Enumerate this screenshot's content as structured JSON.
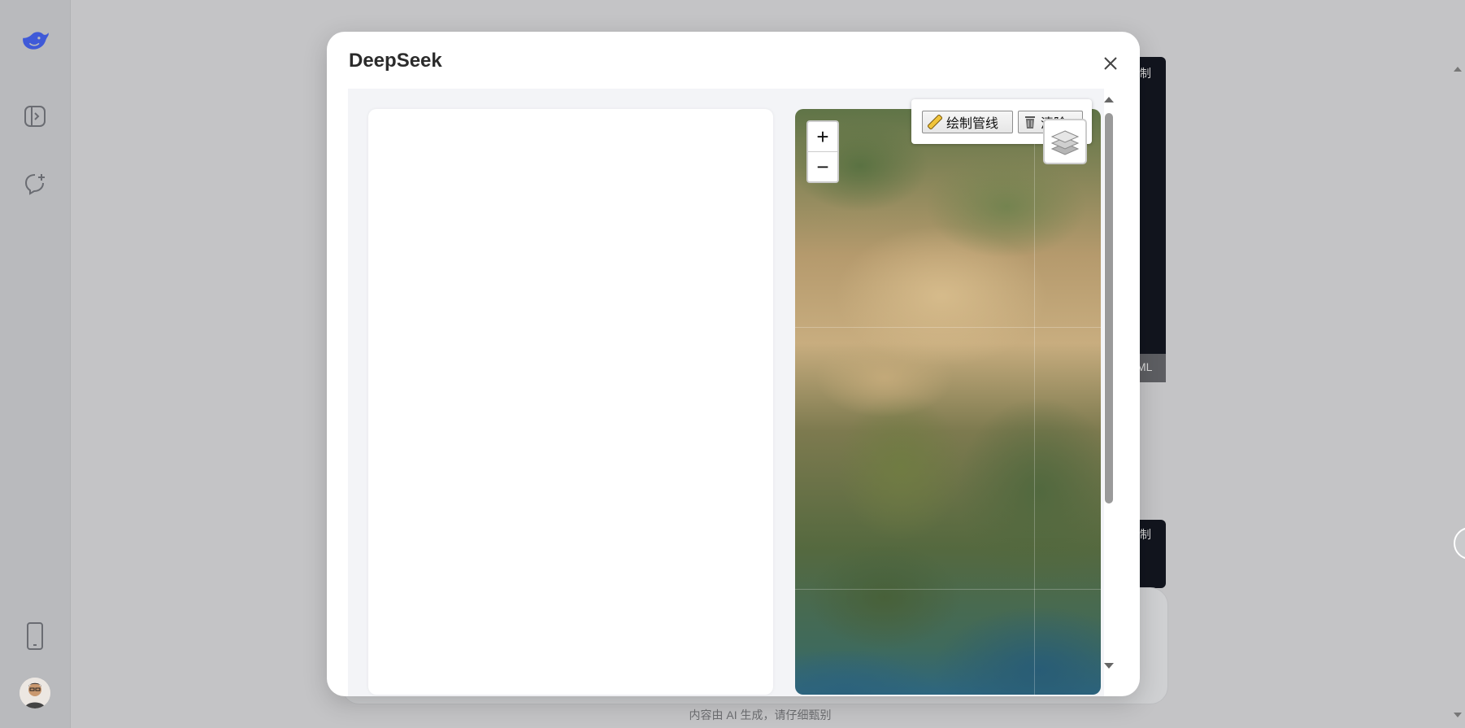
{
  "background": {
    "panel_top_label": "制",
    "panel_top_footer": "ML",
    "panel_bottom_label": "制",
    "footer_note": "内容由 AI 生成，请仔细甄别"
  },
  "sidebar": {
    "logo": "deepseek-whale-icon",
    "items": [
      {
        "icon": "sidebar-toggle-icon"
      },
      {
        "icon": "new-chat-icon"
      },
      {
        "icon": "mobile-app-icon"
      }
    ]
  },
  "modal": {
    "title": "DeepSeek",
    "close_icon": "close-icon",
    "map": {
      "zoom_in": "+",
      "zoom_out": "−",
      "tools": {
        "draw_pipeline": "绘制管线",
        "clear": "清除"
      },
      "layers_icon": "layers-icon"
    }
  },
  "colors": {
    "accent": "#4d6bfe",
    "overlay": "#c4c4c6",
    "panel": "#12151e"
  }
}
